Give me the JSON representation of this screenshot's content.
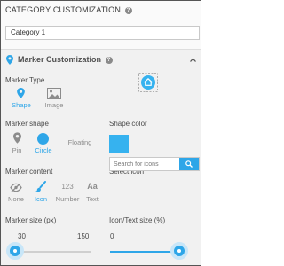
{
  "header": {
    "title": "CATEGORY CUSTOMIZATION",
    "help_icon": "question-circle-icon"
  },
  "category_name": {
    "value": "Category 1"
  },
  "marker_section": {
    "title": "Marker Customization",
    "collapse_icon": "chevron-up-icon",
    "marker_type": {
      "label": "Marker Type",
      "options": [
        {
          "label": "Shape",
          "icon": "map-pin-icon",
          "selected": true
        },
        {
          "label": "Image",
          "icon": "image-icon",
          "selected": false
        }
      ],
      "preview_icon": "home-icon"
    },
    "marker_shape": {
      "label": "Marker shape",
      "options": [
        {
          "label": "Pin",
          "icon": "pin-icon",
          "selected": false
        },
        {
          "label": "Circle",
          "icon": "circle-icon",
          "selected": true
        },
        {
          "label": "Floating",
          "icon": "",
          "selected": false
        }
      ]
    },
    "shape_color": {
      "label": "Shape color",
      "value": "#36b2ef"
    },
    "marker_content": {
      "label": "Marker content",
      "options": [
        {
          "label": "None",
          "icon": "eye-slash-icon",
          "selected": false
        },
        {
          "label": "Icon",
          "icon": "paint-brush-icon",
          "selected": true
        },
        {
          "label": "Number",
          "text": "123",
          "selected": false
        },
        {
          "label": "Text",
          "text": "Aa",
          "selected": false
        }
      ]
    },
    "select_icon": {
      "label": "Select icon",
      "placeholder": "Search for icons",
      "button_icon": "search-icon"
    },
    "marker_size": {
      "label": "Marker size (px)",
      "min": "30",
      "max": "150",
      "value": 30
    },
    "icon_text_size": {
      "label": "Icon/Text size (%)",
      "min": "0",
      "value_fraction": 1.0
    }
  },
  "colors": {
    "accent": "#2ea6e8",
    "inactive_icon": "#8c8c8c",
    "panel_bg": "#f1f1f1"
  }
}
